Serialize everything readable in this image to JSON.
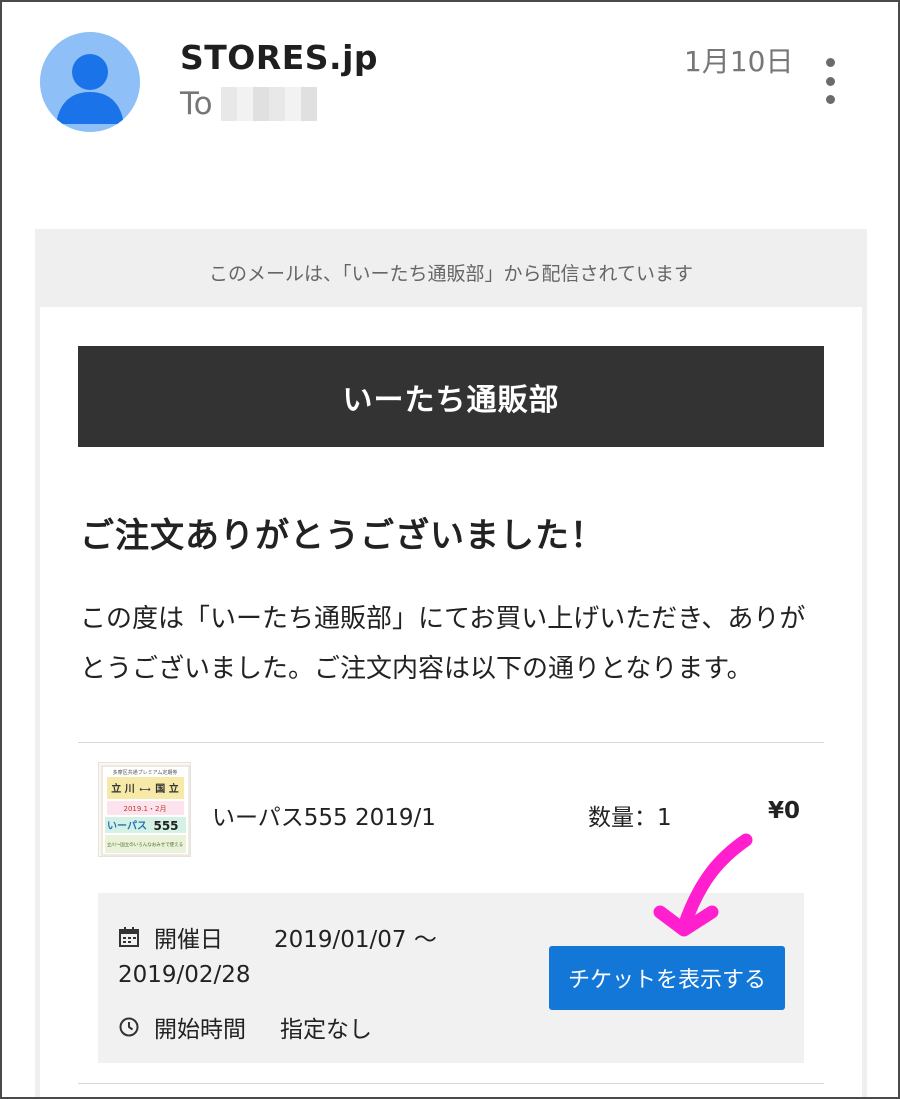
{
  "header": {
    "sender": "STORES.jp",
    "to_label": "To",
    "date": "1月10日"
  },
  "email": {
    "banner": "このメールは、「いーたち通販部」から配信されています",
    "shop_name": "いーたち通販部",
    "title": "ご注文ありがとうございました！",
    "intro": "この度は「いーたち通販部」にてお買い上げいただき、ありがとうございました。ご注文内容は以下の通りとなります。",
    "item": {
      "name": "いーパス555 2019/1",
      "quantity": "数量：1",
      "price": "¥0",
      "thumbnail_text": {
        "top": "多摩区共通プレミアム定期券",
        "route_from": "立 川",
        "route_to": "国 立",
        "dates": "2019.1・2月",
        "brand": "いーパス",
        "brand_accent": "555",
        "footer": "立川〜国立のいろんなおみせで使える"
      }
    },
    "details": {
      "date_label": "開催日",
      "date_value": "2019/01/07 〜",
      "date_value_end": "2019/02/28",
      "time_label": "開始時間",
      "time_value": "指定なし",
      "ticket_button": "チケットを表示する"
    }
  },
  "colors": {
    "avatar": "#8ec0f7",
    "shop_header": "#333333",
    "button": "#1377d8",
    "annotation_arrow": "#ff1fcf"
  }
}
